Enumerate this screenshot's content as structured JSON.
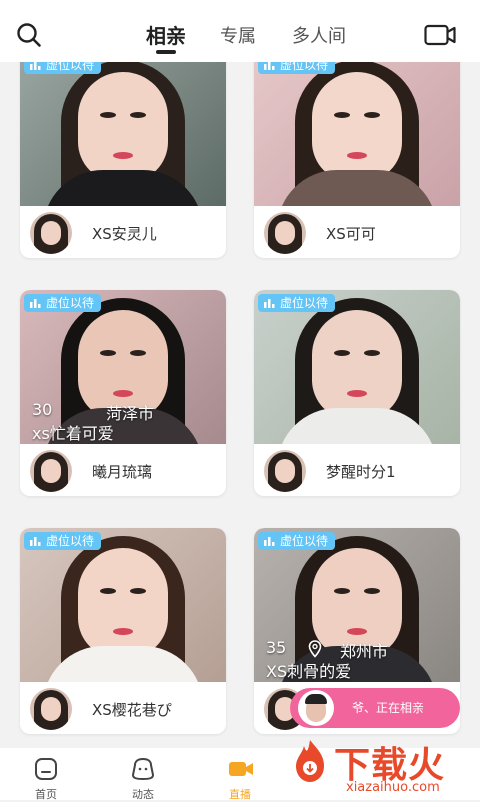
{
  "header": {
    "tabs": [
      {
        "label": "相亲"
      },
      {
        "label": "专属"
      },
      {
        "label": "多人间"
      }
    ],
    "active_tab": 0
  },
  "badge_label": "虚位以待",
  "cards": [
    {
      "name": "XS安灵儿",
      "info_age": "",
      "info_city": "",
      "info_text": ""
    },
    {
      "name": "XS可可",
      "info_age": "",
      "info_city": "",
      "info_text": ""
    },
    {
      "name": "曦月琉璃",
      "info_age": "30",
      "info_city": "菏泽市",
      "info_text": "xs忙着可爱"
    },
    {
      "name": "梦醒时分1",
      "info_age": "",
      "info_city": "",
      "info_text": ""
    },
    {
      "name": "XS樱花巷ぴ",
      "info_age": "",
      "info_city": "",
      "info_text": ""
    },
    {
      "name": "",
      "info_age": "35",
      "info_city": "郑州市",
      "info_text": "XS刺骨的爱"
    }
  ],
  "live_pill": {
    "text": "爷、正在相亲"
  },
  "bottom_nav": [
    {
      "label": "首页",
      "icon": "home-icon"
    },
    {
      "label": "动态",
      "icon": "moments-icon"
    },
    {
      "label": "直播",
      "icon": "live-camera-icon"
    }
  ],
  "watermark": {
    "brand": "下载火",
    "url": "xiazaihuo.com"
  },
  "colors": {
    "badge": "#64c4f6",
    "live_pill": "#f2659c",
    "active_nav": "#f5a623",
    "watermark": "#e8492a"
  }
}
